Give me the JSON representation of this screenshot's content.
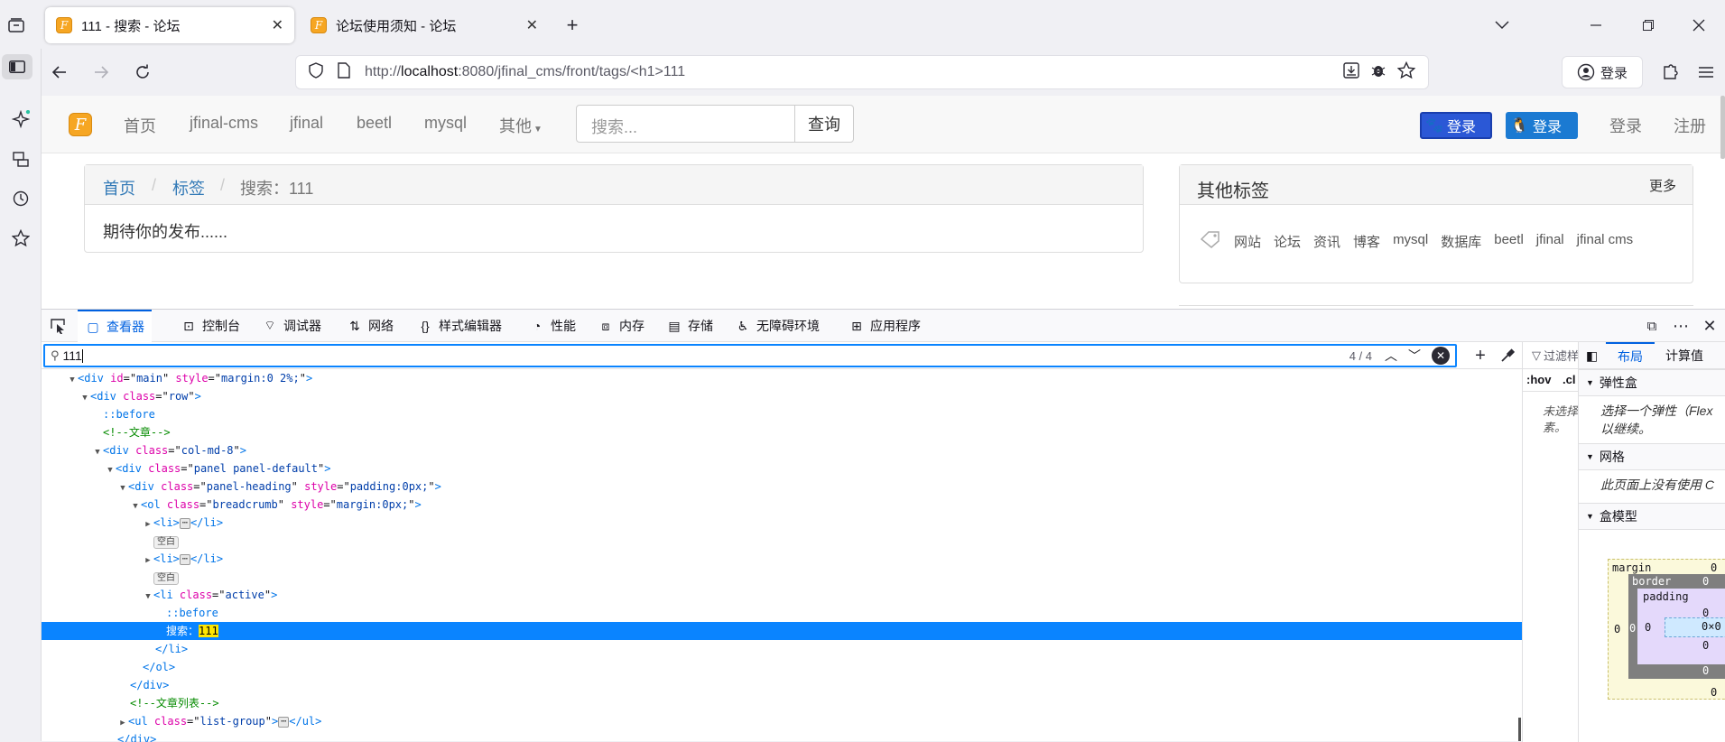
{
  "browser": {
    "tabs": [
      {
        "title": "111 - 搜索 - 论坛",
        "active": true
      },
      {
        "title": "论坛使用须知 - 论坛",
        "active": false
      }
    ],
    "url": {
      "prefix": "http://",
      "host": "localhost",
      "rest": ":8080/jfinal_cms/front/tags/<h1>111"
    },
    "account_label": "登录"
  },
  "site": {
    "logo_glyph": "F",
    "nav": [
      "首页",
      "jfinal-cms",
      "jfinal",
      "beetl",
      "mysql",
      "其他"
    ],
    "search_placeholder": "搜索...",
    "search_button": "查询",
    "social_login": [
      "登录",
      "登录"
    ],
    "login": "登录",
    "register": "注册",
    "breadcrumb": [
      "首页",
      "标签",
      "搜索：111"
    ],
    "breadcrumb_sep": "/",
    "empty_message": "期待你的发布......",
    "other_tags_title": "其他标签",
    "more": "更多",
    "tags": [
      "网站",
      "论坛",
      "资讯",
      "博客",
      "mysql",
      "数据库",
      "beetl",
      "jfinal",
      "jfinal cms"
    ]
  },
  "devtools": {
    "tabs": [
      "查看器",
      "控制台",
      "调试器",
      "网络",
      "样式编辑器",
      "性能",
      "内存",
      "存储",
      "无障碍环境",
      "应用程序"
    ],
    "search_value": "111",
    "search_count": "4 / 4",
    "rules_labels": {
      "filter": "过滤样",
      "hov": ":hov",
      "cls": ".cl",
      "no_selection": "未选择",
      "element": "素。"
    },
    "layout_tabs": [
      "布局",
      "计算值"
    ],
    "sections": [
      {
        "title": "弹性盒",
        "text": [
          "选择一个弹性（Flex",
          "以继续。"
        ]
      },
      {
        "title": "网格",
        "text": [
          "此页面上没有使用 C"
        ]
      },
      {
        "title": "盒模型",
        "text": []
      }
    ],
    "box_model": {
      "margin": "margin",
      "border": "border",
      "padding": "padding",
      "zero": "0",
      "content": "0×0"
    },
    "markup": {
      "l1": {
        "tag": "div",
        "attrs": [
          [
            "id",
            "main"
          ],
          [
            "style",
            "margin:0 2%;"
          ]
        ]
      },
      "l2": {
        "tag": "div",
        "attrs": [
          [
            "class",
            "row"
          ]
        ]
      },
      "before": "::before",
      "comment1": "<!--文章-->",
      "l4": {
        "tag": "div",
        "attrs": [
          [
            "class",
            "col-md-8"
          ]
        ]
      },
      "l5": {
        "tag": "div",
        "attrs": [
          [
            "class",
            "panel panel-default"
          ]
        ]
      },
      "l6": {
        "tag": "div",
        "attrs": [
          [
            "class",
            "panel-heading"
          ],
          [
            "style",
            "padding:0px;"
          ]
        ]
      },
      "l7": {
        "tag": "ol",
        "attrs": [
          [
            "class",
            "breadcrumb"
          ],
          [
            "style",
            "margin:0px;"
          ]
        ]
      },
      "whitespace": "空白",
      "li_active": {
        "tag": "li",
        "attrs": [
          [
            "class",
            "active"
          ]
        ]
      },
      "selected_text_prefix": "搜索：",
      "selected_text_match": "111",
      "close_li": "</li>",
      "close_ol": "</ol>",
      "close_div": "</div>",
      "comment2": "<!--文章列表-->",
      "ul": {
        "tag": "ul",
        "attrs": [
          [
            "class",
            "list-group"
          ]
        ]
      }
    }
  }
}
